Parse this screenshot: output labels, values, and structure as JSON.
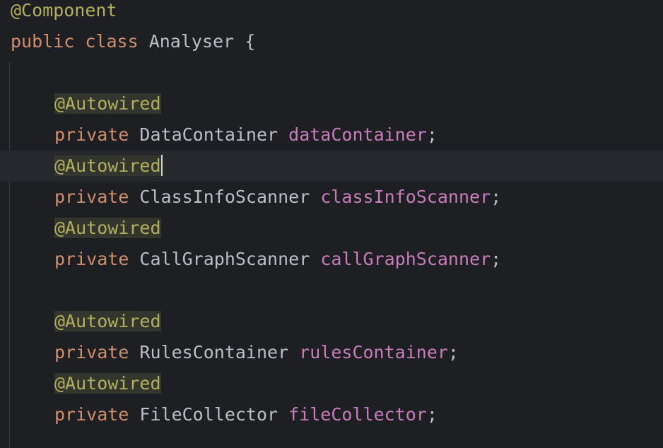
{
  "editor": {
    "language": "Java",
    "colors": {
      "background": "#1e1f22",
      "current_line": "#26282e",
      "keyword": "#cf8e6d",
      "annotation": "#b3ae60",
      "annotation_highlight": "#32362d",
      "field": "#c77dbb",
      "default_text": "#bcbec4"
    },
    "lines": [
      {
        "annotation": "@Component"
      },
      {
        "kw1": "public",
        "kw2": "class",
        "name": "Analyser",
        "brace": "{"
      },
      {},
      {
        "annotation": "@Autowired"
      },
      {
        "kw": "private",
        "type": "DataContainer",
        "field": "dataContainer",
        "semi": ";"
      },
      {
        "annotation": "@Autowired"
      },
      {
        "kw": "private",
        "type": "ClassInfoScanner",
        "field": "classInfoScanner",
        "semi": ";"
      },
      {
        "annotation": "@Autowired"
      },
      {
        "kw": "private",
        "type": "CallGraphScanner",
        "field": "callGraphScanner",
        "semi": ";"
      },
      {},
      {
        "annotation": "@Autowired"
      },
      {
        "kw": "private",
        "type": "RulesContainer",
        "field": "rulesContainer",
        "semi": ";"
      },
      {
        "annotation": "@Autowired"
      },
      {
        "kw": "private",
        "type": "FileCollector",
        "field": "fileCollector",
        "semi": ";"
      }
    ]
  }
}
